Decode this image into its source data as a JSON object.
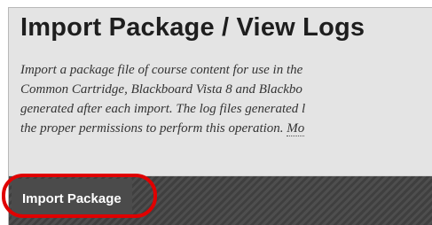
{
  "header": {
    "title": "Import Package / View Logs",
    "description_lines": [
      "Import a package file of course content for use in the",
      "Common Cartridge, Blackboard Vista 8 and Blackbo",
      "generated after each import. The log files generated l",
      "the proper permissions to perform this operation. "
    ],
    "more_link": "Mo"
  },
  "action_bar": {
    "import_button_label": "Import Package"
  },
  "colors": {
    "highlight_ring": "#e00000",
    "action_bar": "#4a4a4a"
  }
}
